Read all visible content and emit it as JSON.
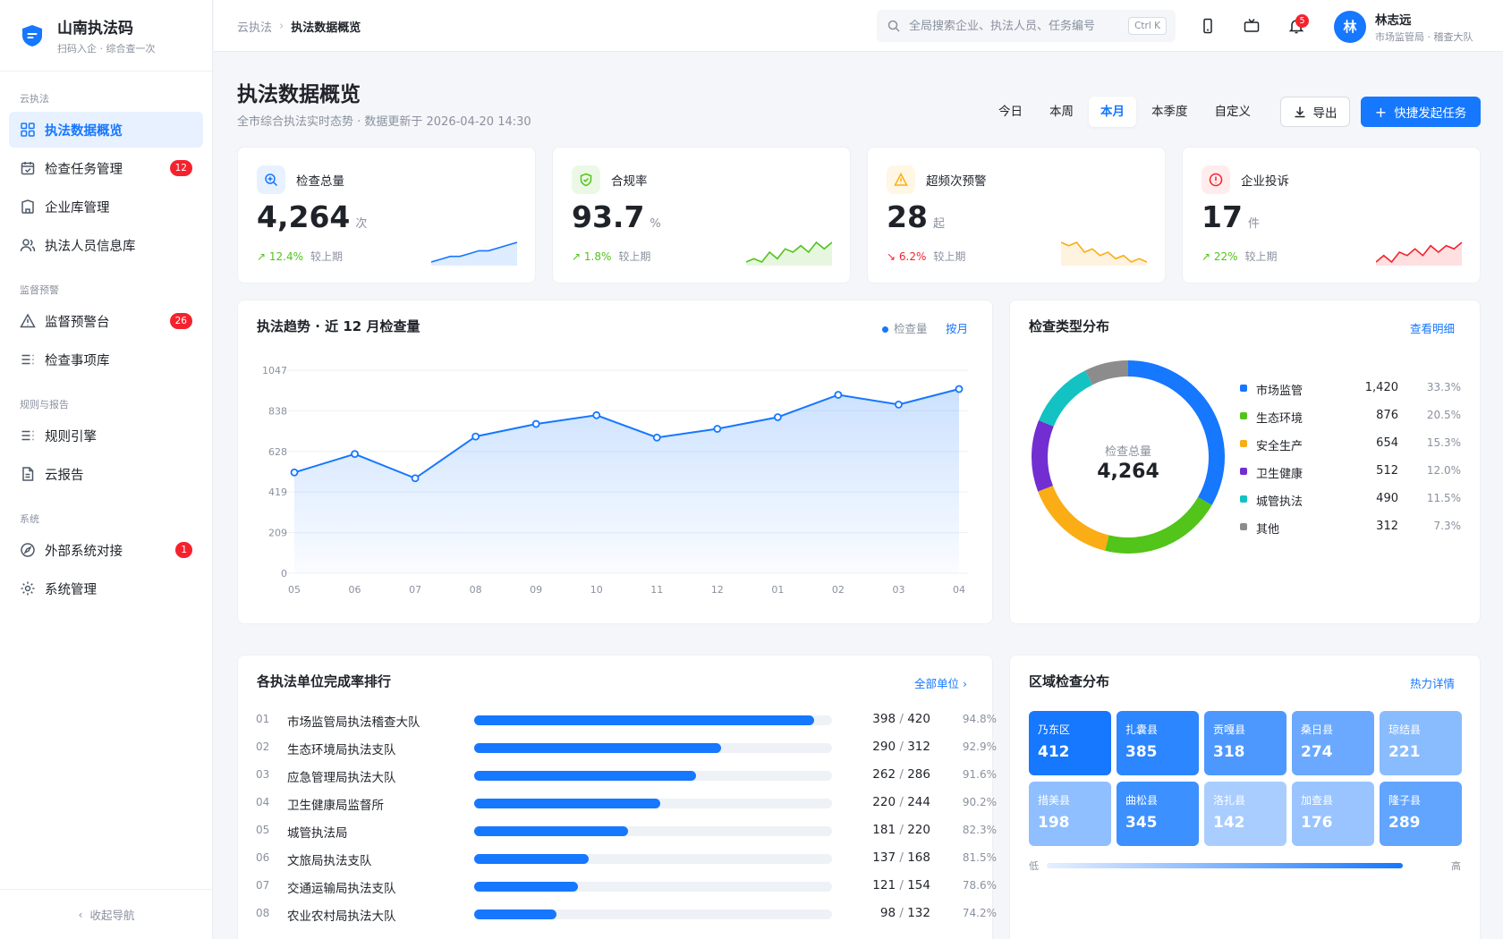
{
  "brand": {
    "title": "山南执法码",
    "subtitle": "扫码入企 · 综合查一次"
  },
  "sidebar": {
    "groups": [
      {
        "title": "云执法",
        "items": [
          {
            "label": "执法数据概览",
            "active": true
          },
          {
            "label": "检查任务管理",
            "badge": "12"
          },
          {
            "label": "企业库管理"
          },
          {
            "label": "执法人员信息库"
          }
        ]
      },
      {
        "title": "监督预警",
        "items": [
          {
            "label": "监督预警台",
            "badge": "26"
          },
          {
            "label": "检查事项库"
          }
        ]
      },
      {
        "title": "规则与报告",
        "items": [
          {
            "label": "规则引擎"
          },
          {
            "label": "云报告"
          }
        ]
      },
      {
        "title": "系统",
        "items": [
          {
            "label": "外部系统对接",
            "badge": "1"
          },
          {
            "label": "系统管理"
          }
        ]
      }
    ],
    "collapse_label": "收起导航"
  },
  "topbar": {
    "breadcrumb": [
      "云执法",
      "执法数据概览"
    ],
    "search_placeholder": "全局搜索企业、执法人员、任务编号",
    "search_shortcut": "Ctrl K",
    "notification_count": "5",
    "user": {
      "avatar": "林",
      "name": "林志远",
      "role": "市场监管局 · 稽查大队"
    }
  },
  "page": {
    "title": "执法数据概览",
    "subtitle": "全市综合执法实时态势 · 数据更新于 2026-04-20 14:30",
    "ranges": [
      "今日",
      "本周",
      "本月",
      "本季度",
      "自定义"
    ],
    "active_range": "本月",
    "export_label": "导出",
    "primary_label": "快捷发起任务"
  },
  "kpis": [
    {
      "title": "检查总量",
      "value": "4,264",
      "unit": "次",
      "change": "12.4%",
      "direction": "up",
      "compare": "较上期",
      "color": "#1677ff",
      "spark": [
        3,
        4,
        5,
        5,
        6,
        7,
        7,
        8,
        9,
        10
      ]
    },
    {
      "title": "合规率",
      "value": "93.7",
      "unit": "%",
      "change": "1.8%",
      "direction": "up",
      "compare": "较上期",
      "color": "#52c41a",
      "spark": [
        3,
        4,
        3,
        6,
        4,
        7,
        6,
        8,
        6,
        9,
        7,
        9
      ]
    },
    {
      "title": "超频次预警",
      "value": "28",
      "unit": "起",
      "change": "6.2%",
      "direction": "down",
      "compare": "较上期",
      "color": "#faad14",
      "spark": [
        9,
        8,
        9,
        6,
        7,
        5,
        6,
        4,
        5,
        3,
        4,
        3
      ]
    },
    {
      "title": "企业投诉",
      "value": "17",
      "unit": "件",
      "change": "22%",
      "direction": "up",
      "compare": "较上期",
      "color": "#f5222d",
      "spark": [
        3,
        5,
        3,
        6,
        5,
        7,
        5,
        8,
        6,
        8,
        7,
        9
      ]
    }
  ],
  "trend": {
    "title": "执法趋势 · 近 12 月检查量",
    "legend": "检查量",
    "granularity": "按月"
  },
  "distribution": {
    "title": "检查类型分布",
    "link": "查看明细",
    "center_label": "检查总量",
    "center_value": "4,264",
    "items": [
      {
        "name": "市场监管",
        "value": "1,420",
        "pct": "33.3%",
        "color": "#1677ff"
      },
      {
        "name": "生态环境",
        "value": "876",
        "pct": "20.5%",
        "color": "#52c41a"
      },
      {
        "name": "安全生产",
        "value": "654",
        "pct": "15.3%",
        "color": "#faad14"
      },
      {
        "name": "卫生健康",
        "value": "512",
        "pct": "12.0%",
        "color": "#722ed1"
      },
      {
        "name": "城管执法",
        "value": "490",
        "pct": "11.5%",
        "color": "#13c2c2"
      },
      {
        "name": "其他",
        "value": "312",
        "pct": "7.3%",
        "color": "#8c8c8c"
      }
    ]
  },
  "ranking": {
    "title": "各执法单位完成率排行",
    "link": "全部单位 ›",
    "rows": [
      {
        "no": "01",
        "name": "市场监管局执法稽查大队",
        "done": "398",
        "total": "420",
        "pct": "94.8%",
        "rate": 0.95
      },
      {
        "no": "02",
        "name": "生态环境局执法支队",
        "done": "290",
        "total": "312",
        "pct": "92.9%",
        "rate": 0.69
      },
      {
        "no": "03",
        "name": "应急管理局执法大队",
        "done": "262",
        "total": "286",
        "pct": "91.6%",
        "rate": 0.62
      },
      {
        "no": "04",
        "name": "卫生健康局监督所",
        "done": "220",
        "total": "244",
        "pct": "90.2%",
        "rate": 0.52
      },
      {
        "no": "05",
        "name": "城管执法局",
        "done": "181",
        "total": "220",
        "pct": "82.3%",
        "rate": 0.43
      },
      {
        "no": "06",
        "name": "文旅局执法支队",
        "done": "137",
        "total": "168",
        "pct": "81.5%",
        "rate": 0.32
      },
      {
        "no": "07",
        "name": "交通运输局执法支队",
        "done": "121",
        "total": "154",
        "pct": "78.6%",
        "rate": 0.29
      },
      {
        "no": "08",
        "name": "农业农村局执法大队",
        "done": "98",
        "total": "132",
        "pct": "74.2%",
        "rate": 0.23
      }
    ]
  },
  "region": {
    "title": "区域检查分布",
    "link": "热力详情",
    "scale_low": "低",
    "scale_high": "高",
    "cells": [
      {
        "name": "乃东区",
        "value": "412",
        "color": "#1677ff"
      },
      {
        "name": "扎囊县",
        "value": "385",
        "color": "#2b86ff"
      },
      {
        "name": "贡嘎县",
        "value": "318",
        "color": "#4c98ff"
      },
      {
        "name": "桑日县",
        "value": "274",
        "color": "#6aa9ff"
      },
      {
        "name": "琼结县",
        "value": "221",
        "color": "#89bbff"
      },
      {
        "name": "措美县",
        "value": "198",
        "color": "#8fbfff"
      },
      {
        "name": "曲松县",
        "value": "345",
        "color": "#3d90ff"
      },
      {
        "name": "洛扎县",
        "value": "142",
        "color": "#a9cdff"
      },
      {
        "name": "加查县",
        "value": "176",
        "color": "#99c4ff"
      },
      {
        "name": "隆子县",
        "value": "289",
        "color": "#62a5ff"
      }
    ]
  },
  "chart_data": {
    "type": "area",
    "categories": [
      "05",
      "06",
      "07",
      "08",
      "09",
      "10",
      "11",
      "12",
      "01",
      "02",
      "03",
      "04"
    ],
    "series": [
      {
        "name": "检查量",
        "values": [
          520,
          615,
          490,
          705,
          770,
          815,
          700,
          745,
          805,
          920,
          870,
          950
        ]
      }
    ],
    "y_ticks": [
      0,
      209,
      419,
      628,
      838,
      1047
    ],
    "ylim": [
      0,
      1047
    ],
    "grid": true,
    "legend": "top-right"
  }
}
